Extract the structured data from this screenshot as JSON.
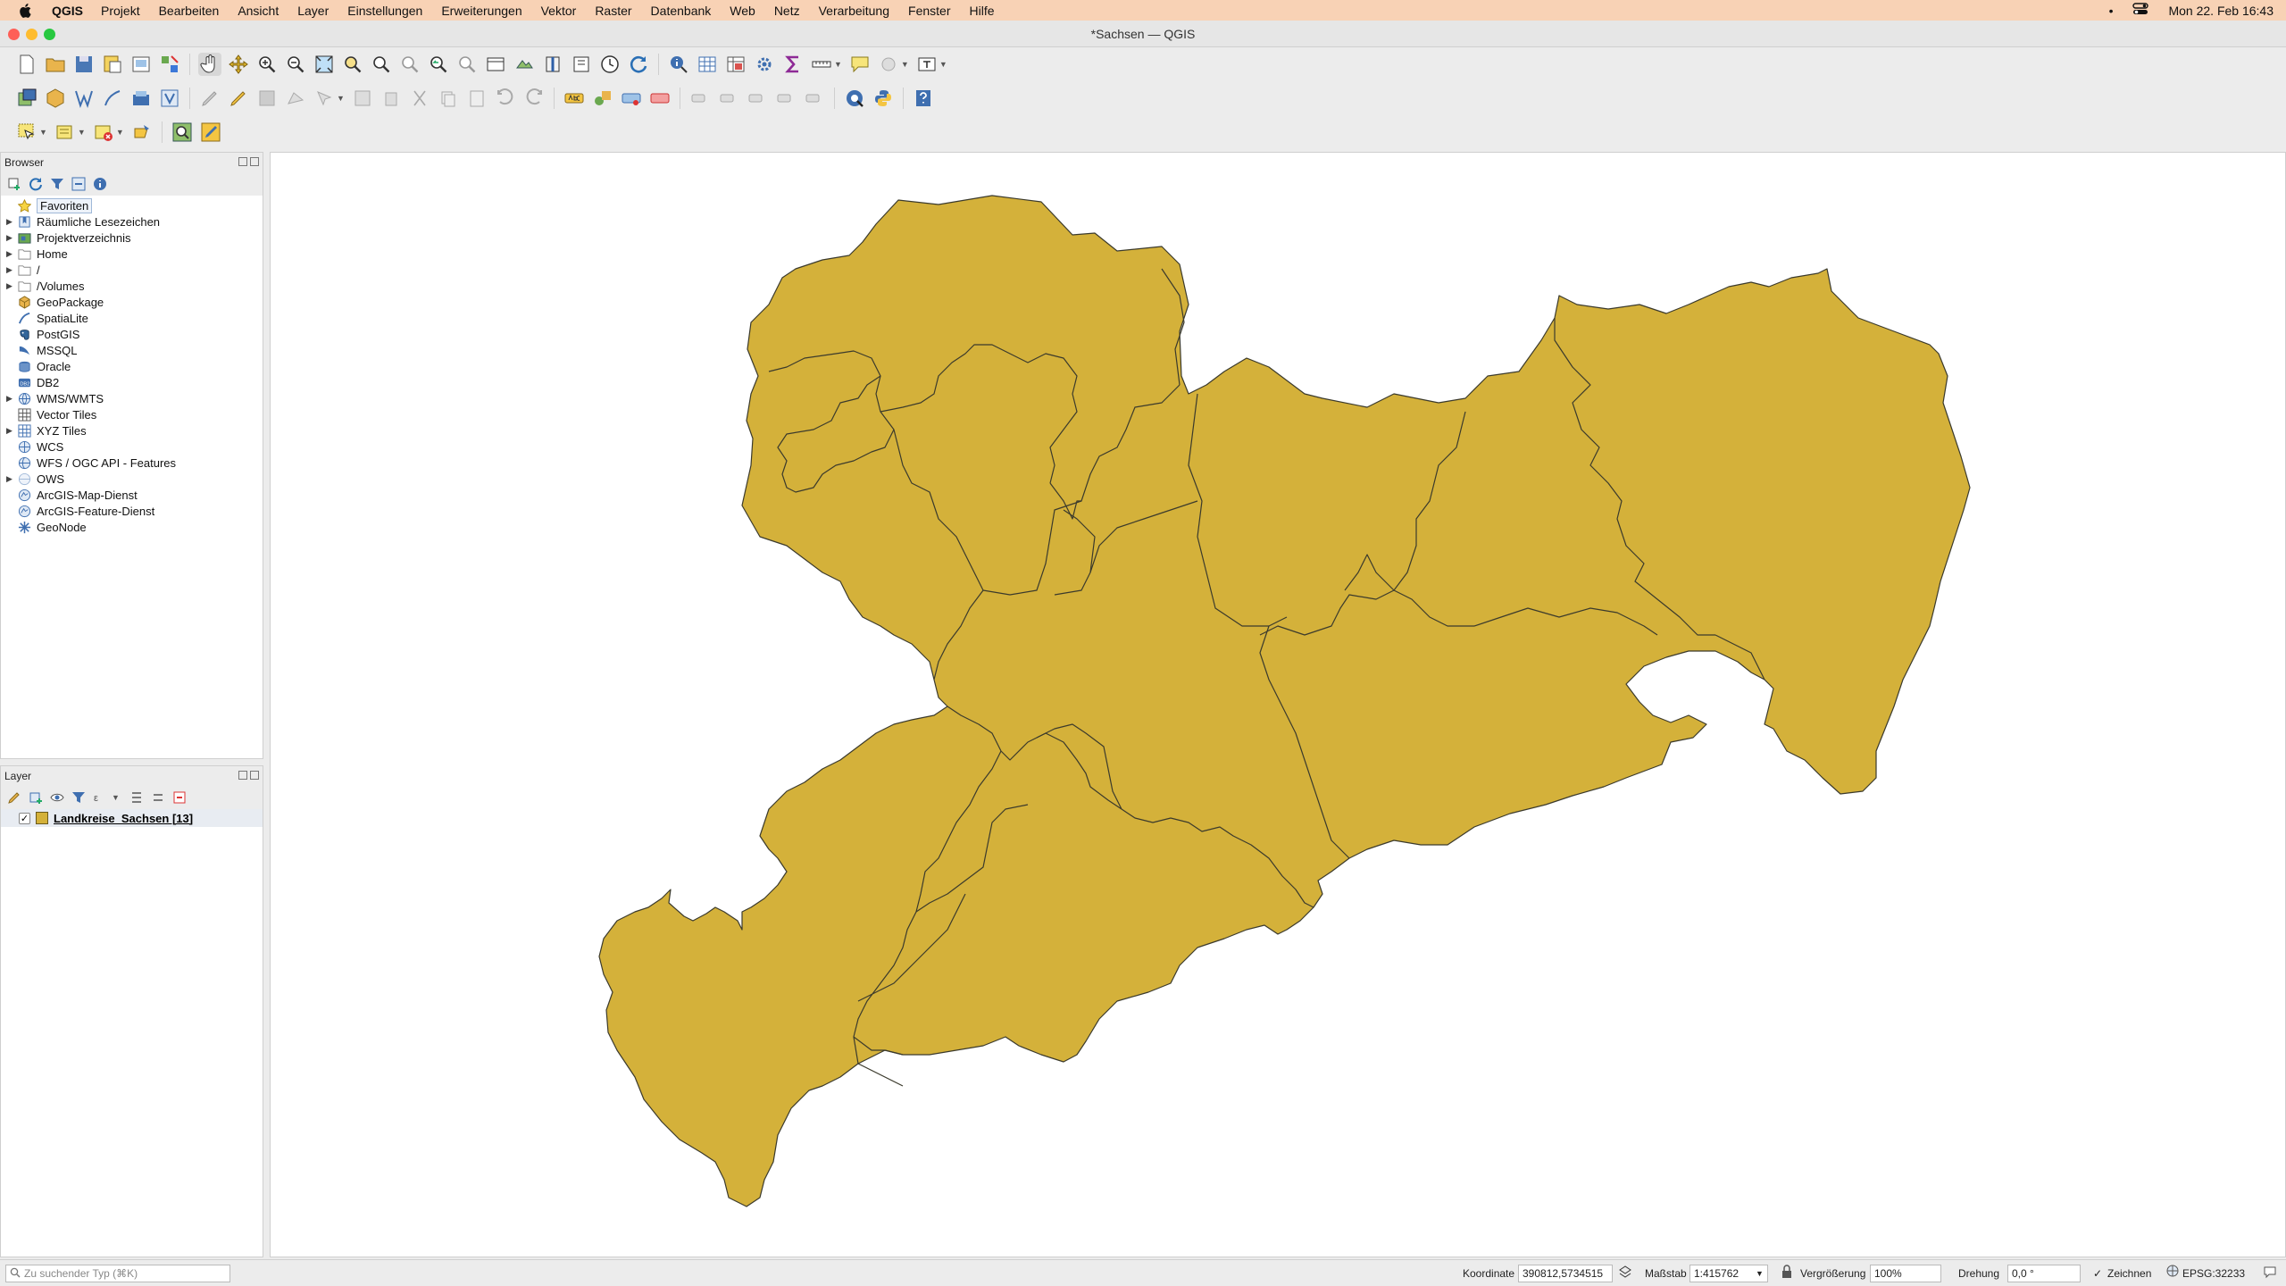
{
  "menubar": {
    "app": "QGIS",
    "items": [
      "Projekt",
      "Bearbeiten",
      "Ansicht",
      "Layer",
      "Einstellungen",
      "Erweiterungen",
      "Vektor",
      "Raster",
      "Datenbank",
      "Web",
      "Netz",
      "Verarbeitung",
      "Fenster",
      "Hilfe"
    ],
    "clock": "Mon 22. Feb  16:43",
    "dot": "•"
  },
  "window": {
    "title": "*Sachsen — QGIS"
  },
  "browser": {
    "title": "Browser",
    "items": [
      {
        "label": "Favoriten",
        "icon": "star-icon",
        "expandable": false
      },
      {
        "label": "Räumliche Lesezeichen",
        "icon": "bookmark-icon",
        "expandable": true
      },
      {
        "label": "Projektverzeichnis",
        "icon": "project-folder-icon",
        "expandable": true
      },
      {
        "label": "Home",
        "icon": "folder-icon",
        "expandable": true
      },
      {
        "label": "/",
        "icon": "folder-icon",
        "expandable": true
      },
      {
        "label": "/Volumes",
        "icon": "folder-icon",
        "expandable": true
      },
      {
        "label": "GeoPackage",
        "icon": "geopackage-icon",
        "expandable": false
      },
      {
        "label": "SpatiaLite",
        "icon": "spatialite-icon",
        "expandable": false
      },
      {
        "label": "PostGIS",
        "icon": "postgis-icon",
        "expandable": false
      },
      {
        "label": "MSSQL",
        "icon": "mssql-icon",
        "expandable": false
      },
      {
        "label": "Oracle",
        "icon": "oracle-icon",
        "expandable": false
      },
      {
        "label": "DB2",
        "icon": "db2-icon",
        "expandable": false
      },
      {
        "label": "WMS/WMTS",
        "icon": "wms-icon",
        "expandable": true
      },
      {
        "label": "Vector Tiles",
        "icon": "grid-icon",
        "expandable": false
      },
      {
        "label": "XYZ Tiles",
        "icon": "grid-icon",
        "expandable": true
      },
      {
        "label": "WCS",
        "icon": "wcs-icon",
        "expandable": false
      },
      {
        "label": "WFS / OGC API - Features",
        "icon": "wfs-icon",
        "expandable": false
      },
      {
        "label": "OWS",
        "icon": "ows-icon",
        "expandable": true
      },
      {
        "label": "ArcGIS-Map-Dienst",
        "icon": "arcgis-map-icon",
        "expandable": false
      },
      {
        "label": "ArcGIS-Feature-Dienst",
        "icon": "arcgis-feature-icon",
        "expandable": false
      },
      {
        "label": "GeoNode",
        "icon": "geonode-icon",
        "expandable": false
      }
    ]
  },
  "layers": {
    "title": "Layer",
    "items": [
      {
        "label": "Landkreise_Sachsen [13]",
        "checked": true,
        "color": "#d4b13a"
      }
    ]
  },
  "search": {
    "placeholder": "Zu suchender Typ (⌘K)"
  },
  "status": {
    "coord_label": "Koordinate",
    "coord_value": "390812,5734515",
    "scale_label": "Maßstab",
    "scale_value": "1:415762",
    "magnifier_label": "Vergrößerung",
    "magnifier_value": "100%",
    "rotation_label": "Drehung",
    "rotation_value": "0,0 °",
    "render_label": "Zeichnen",
    "crs": "EPSG:32233"
  },
  "colors": {
    "fill": "#d4b13a",
    "stroke": "#3b3a2c"
  }
}
